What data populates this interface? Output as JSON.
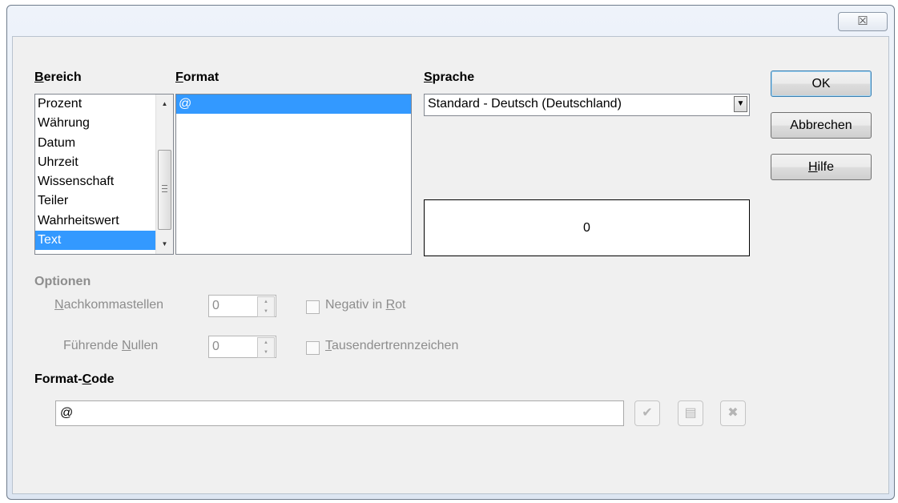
{
  "window": {
    "close_glyph": "☒"
  },
  "bereich": {
    "label_first": "B",
    "label_rest": "ereich",
    "items": [
      {
        "label": "Prozent",
        "selected": false
      },
      {
        "label": "Währung",
        "selected": false
      },
      {
        "label": "Datum",
        "selected": false
      },
      {
        "label": "Uhrzeit",
        "selected": false
      },
      {
        "label": "Wissenschaft",
        "selected": false
      },
      {
        "label": "Teiler",
        "selected": false
      },
      {
        "label": "Wahrheitswert",
        "selected": false
      },
      {
        "label": "Text",
        "selected": true
      }
    ]
  },
  "format": {
    "label_first": "F",
    "label_rest": "ormat",
    "items": [
      {
        "label": "@",
        "selected": true
      }
    ]
  },
  "sprache": {
    "label_first": "S",
    "label_rest": "prache",
    "selected": "Standard - Deutsch (Deutschland)"
  },
  "preview": {
    "value": "0"
  },
  "buttons": {
    "ok": "OK",
    "cancel": "Abbrechen",
    "help_first": "H",
    "help_rest": "ilfe"
  },
  "optionen": {
    "title": "Optionen",
    "nachkomma_first": "N",
    "nachkomma_rest": "achkommastellen",
    "nachkomma_value": "0",
    "nullen_pre": "Führende ",
    "nullen_u": "N",
    "nullen_post": "ullen",
    "nullen_value": "0",
    "negativ_pre": "Negativ in ",
    "negativ_u": "R",
    "negativ_post": "ot",
    "tausender_first": "T",
    "tausender_rest": "ausendertrennzeichen"
  },
  "formatcode": {
    "label_pre": "Format-",
    "label_u": "C",
    "label_post": "ode",
    "value": "@"
  },
  "colors": {
    "selection": "#3399ff",
    "disabled_text": "#8d8d8d"
  }
}
